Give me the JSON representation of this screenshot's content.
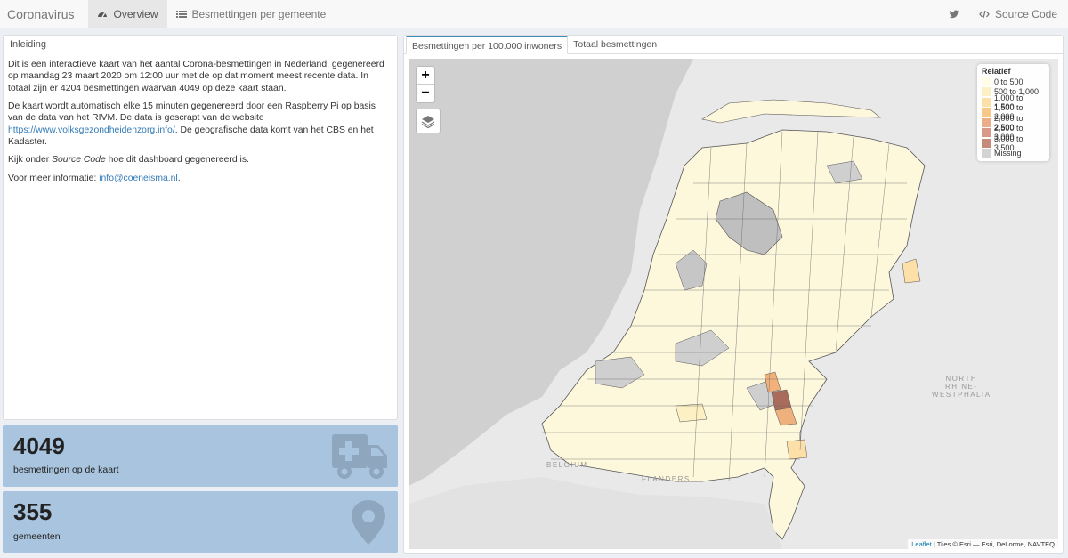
{
  "nav": {
    "brand": "Coronavirus",
    "items": [
      {
        "label": "Overview",
        "icon": "tachometer-icon"
      },
      {
        "label": "Besmettingen per gemeente",
        "icon": "list-icon"
      }
    ],
    "source_code": "Source Code"
  },
  "intro": {
    "header": "Inleiding",
    "p1": "Dit is een interactieve kaart van het aantal Corona-besmettingen in Nederland, gegenereerd op maandag 23 maart 2020 om 12:00 uur met de op dat moment meest recente data. In totaal zijn er 4204 besmettingen waarvan 4049 op deze kaart staan.",
    "p2_pre": "De kaart wordt automatisch elke 15 minuten gegenereerd door een Raspberry Pi op basis van de data van het RIVM. De data is gescrapt van de website ",
    "p2_link": "https://www.volksgezondheidenzorg.info/",
    "p2_post": ". De geografische data komt van het CBS en het Kadaster.",
    "p3_pre": "Kijk onder ",
    "p3_em": "Source Code",
    "p3_post": " hoe dit dashboard gegenereerd is.",
    "p4_pre": "Voor meer informatie: ",
    "p4_link": "info@coeneisma.nl",
    "p4_post": "."
  },
  "valueboxes": [
    {
      "value": "4049",
      "label": "besmettingen op de kaart",
      "icon": "ambulance-icon"
    },
    {
      "value": "355",
      "label": "gemeenten",
      "icon": "map-marker-icon"
    }
  ],
  "map": {
    "tabs": [
      "Besmettingen per 100.000 inwoners",
      "Totaal besmettingen"
    ],
    "zoom_in": "+",
    "zoom_out": "−",
    "legend": {
      "title": "Relatief",
      "items": [
        {
          "label": "0 to 500",
          "color": "#fffde8"
        },
        {
          "label": "500 to 1,000",
          "color": "#fdf0c4"
        },
        {
          "label": "1,000 to 1,500",
          "color": "#fde0a8"
        },
        {
          "label": "1,500 to 2,000",
          "color": "#f8c889"
        },
        {
          "label": "2,000 to 2,500",
          "color": "#eaae88"
        },
        {
          "label": "2,500 to 3,000",
          "color": "#d9998a"
        },
        {
          "label": "3,000 to 3,500",
          "color": "#c48a7a"
        },
        {
          "label": "Missing",
          "color": "#d3d3d3"
        }
      ]
    },
    "labels": {
      "nrw1": "NORTH",
      "nrw2": "RHINE-",
      "nrw3": "WESTPHALIA",
      "belgium": "BELGIUM",
      "flanders": "FLANDERS"
    },
    "attribution_link": "Leaflet",
    "attribution_text": " | Tiles © Esri — Esri, DeLorme, NAVTEQ"
  }
}
